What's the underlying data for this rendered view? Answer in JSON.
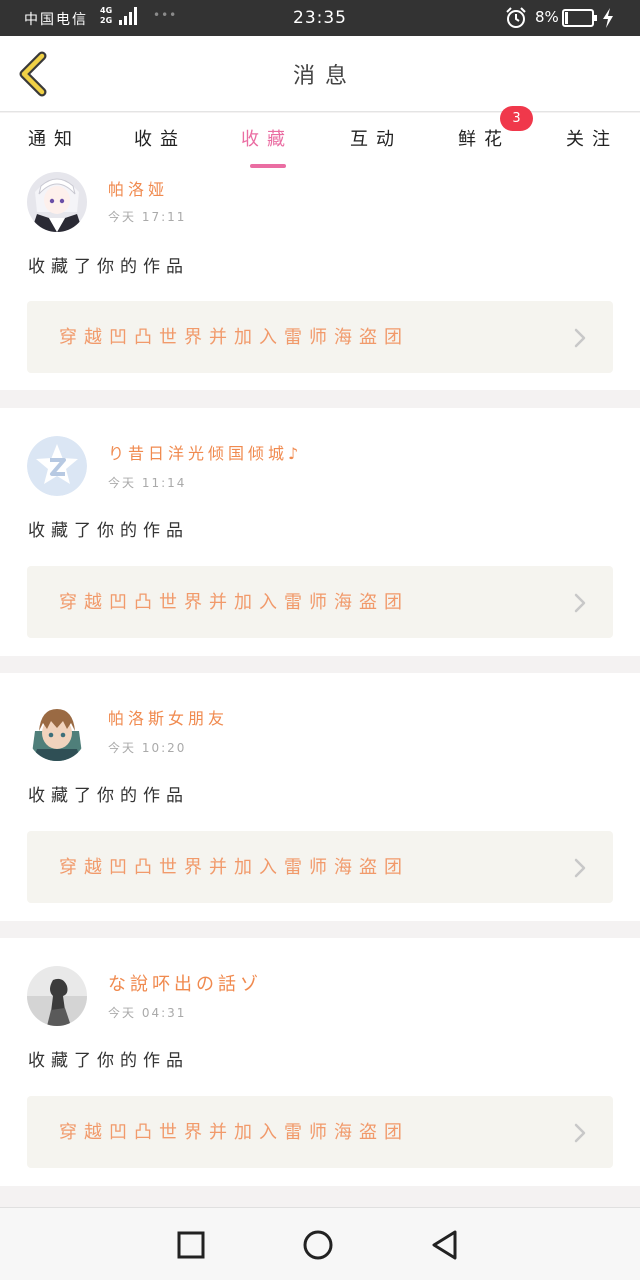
{
  "status_bar": {
    "carrier": "中国电信",
    "network_top": "4G",
    "network_bottom": "2G",
    "time": "23:35",
    "battery": "8%",
    "icons": [
      "signal-icon",
      "alarm-icon",
      "battery-icon",
      "charging-icon"
    ]
  },
  "header": {
    "title": "消息",
    "back_icon": "chevron-left-icon",
    "accent_color": "#f0d146"
  },
  "tabs": [
    {
      "label": "通知"
    },
    {
      "label": "收益"
    },
    {
      "label": "收藏",
      "active": true
    },
    {
      "label": "互动"
    },
    {
      "label": "鲜花",
      "badge": "3"
    },
    {
      "label": "关注"
    }
  ],
  "active_color": "#ea6da2",
  "messages": [
    {
      "name": "帕洛娅",
      "time": "今天 17:11",
      "action": "收藏了你的作品",
      "work_title": "穿越凹凸世界并加入雷师海盗团"
    },
    {
      "name": "り昔日洋光倾国倾城♪",
      "time": "今天 11:14",
      "action": "收藏了你的作品",
      "work_title": "穿越凹凸世界并加入雷师海盗团"
    },
    {
      "name": "帕洛斯女朋友",
      "time": "今天 10:20",
      "action": "收藏了你的作品",
      "work_title": "穿越凹凸世界并加入雷师海盗团"
    },
    {
      "name": "な說吥出の話ゾ",
      "time": "今天 04:31",
      "action": "收藏了你的作品",
      "work_title": "穿越凹凸世界并加入雷师海盗团"
    }
  ],
  "nav": {
    "buttons": [
      "recent-apps-icon",
      "home-icon",
      "back-icon"
    ]
  }
}
